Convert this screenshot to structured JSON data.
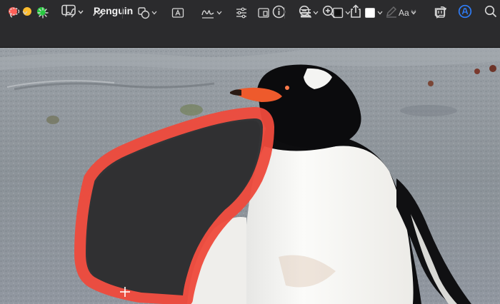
{
  "window": {
    "title": "Penguin",
    "traffic_lights": [
      "close",
      "minimize",
      "zoom"
    ]
  },
  "titlebar_icons": [
    "sidebar-icon",
    "info-icon",
    "zoom-out-icon",
    "zoom-in-icon",
    "share-icon",
    "highlight-pen-icon",
    "rotate-icon",
    "markup-icon",
    "search-icon"
  ],
  "markup_toolbar": {
    "tools": [
      "lasso-selection-icon",
      "instant-alpha-icon",
      "sketch-icon",
      "draw-icon",
      "shapes-icon",
      "text-box-icon",
      "signature-icon",
      "adjust-color-icon",
      "adjust-size-icon",
      "border-style-icon",
      "border-color-icon",
      "fill-color-icon",
      "text-style-icon",
      "description-icon"
    ],
    "text_style_label": "Aa"
  },
  "image": {
    "subject": "penguin-photo",
    "selection_outline_color": "#ef4a3c",
    "selection_fill_color": "#2f2f31"
  },
  "colors": {
    "window_bg": "#2b2b2d",
    "accent": "#2f7cf6",
    "selection": "#ef4a3c"
  }
}
